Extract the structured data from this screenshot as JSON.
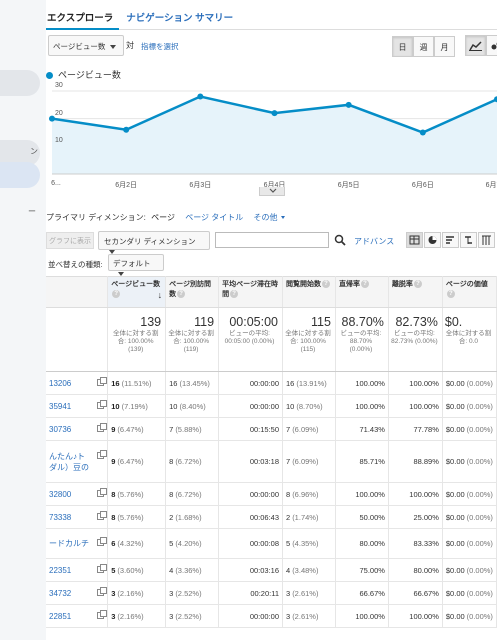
{
  "sidebar": {
    "text_a": "ン",
    "text_b": "ー"
  },
  "tabs": {
    "explorer": "エクスプローラ",
    "nav_summary": "ナビゲーション サマリー"
  },
  "metric_row": {
    "metric_select": "ページビュー数",
    "vs": "対",
    "select_metric_link": "指標を選択",
    "period_day": "日",
    "period_week": "週",
    "period_month": "月"
  },
  "legend": {
    "label": "ページビュー数",
    "color": "#058dc7"
  },
  "chart_data": {
    "type": "area",
    "series": [
      {
        "name": "ページビュー数",
        "values": [
          20,
          16,
          28,
          22,
          25,
          15,
          27
        ]
      }
    ],
    "x": [
      "6...",
      "6月2日",
      "6月3日",
      "6月4日",
      "6月5日",
      "6月6日",
      "6月7"
    ],
    "yticks": [
      "30",
      "20",
      "10"
    ],
    "ylim": [
      0,
      30
    ],
    "grid": true,
    "line_color": "#058dc7",
    "fill_color": "#e6f3fa"
  },
  "dimensions": {
    "label": "プライマリ ディメンション:",
    "active": "ページ",
    "page_title": "ページ タイトル",
    "other": "その他"
  },
  "toolbar": {
    "graph_btn": "グラフに表示",
    "secondary_dim": "セカンダリ ディメンション",
    "search_placeholder": "",
    "advanced": "アドバンス"
  },
  "sort": {
    "label": "並べ替えの種類:",
    "value": "デフォルト"
  },
  "table": {
    "headers": {
      "pv": "ページビュー数",
      "upv": "ページ別訪問数",
      "avg_time": "平均ページ滞在時間",
      "entrances": "閲覧開始数",
      "bounce": "直帰率",
      "exit": "離脱率",
      "value": "ページの価値"
    },
    "summary": {
      "pv": "139",
      "pv_sub": "全体に対する割合: 100.00% (139)",
      "upv": "119",
      "upv_sub": "全体に対する割合: 100.00% (119)",
      "avg_time": "00:05:00",
      "avg_time_sub": "ビューの平均: 00:05:00 (0.00%)",
      "entrances": "115",
      "entrances_sub": "全体に対する割合: 100.00% (115)",
      "bounce": "88.70%",
      "bounce_sub": "ビューの平均: 88.70% (0.00%)",
      "exit": "82.73%",
      "exit_sub": "ビューの平均: 82.73% (0.00%)",
      "value": "$0.",
      "value_sub": "全体に対する割合: 0.0"
    },
    "rows": [
      {
        "page": "13206",
        "pv": "16",
        "pv_pct": "(11.51%)",
        "upv": "16",
        "upv_pct": "(13.45%)",
        "avg": "00:00:00",
        "ent": "16",
        "ent_pct": "(13.91%)",
        "bounce": "100.00%",
        "exit": "100.00%",
        "value": "$0.00",
        "value_pct": "(0.00%)"
      },
      {
        "page": "35941",
        "pv": "10",
        "pv_pct": "(7.19%)",
        "upv": "10",
        "upv_pct": "(8.40%)",
        "avg": "00:00:00",
        "ent": "10",
        "ent_pct": "(8.70%)",
        "bounce": "100.00%",
        "exit": "100.00%",
        "value": "$0.00",
        "value_pct": "(0.00%)"
      },
      {
        "page": "30736",
        "pv": "9",
        "pv_pct": "(6.47%)",
        "upv": "7",
        "upv_pct": "(5.88%)",
        "avg": "00:15:50",
        "ent": "7",
        "ent_pct": "(6.09%)",
        "bounce": "71.43%",
        "exit": "77.78%",
        "value": "$0.00",
        "value_pct": "(0.00%)"
      },
      {
        "page": "んたん♪ト\nダル）豆の",
        "pv": "9",
        "pv_pct": "(6.47%)",
        "upv": "8",
        "upv_pct": "(6.72%)",
        "avg": "00:03:18",
        "ent": "7",
        "ent_pct": "(6.09%)",
        "bounce": "85.71%",
        "exit": "88.89%",
        "value": "$0.00",
        "value_pct": "(0.00%)"
      },
      {
        "page": "32800",
        "pv": "8",
        "pv_pct": "(5.76%)",
        "upv": "8",
        "upv_pct": "(6.72%)",
        "avg": "00:00:00",
        "ent": "8",
        "ent_pct": "(6.96%)",
        "bounce": "100.00%",
        "exit": "100.00%",
        "value": "$0.00",
        "value_pct": "(0.00%)"
      },
      {
        "page": "73338",
        "pv": "8",
        "pv_pct": "(5.76%)",
        "upv": "2",
        "upv_pct": "(1.68%)",
        "avg": "00:06:43",
        "ent": "2",
        "ent_pct": "(1.74%)",
        "bounce": "50.00%",
        "exit": "25.00%",
        "value": "$0.00",
        "value_pct": "(0.00%)"
      },
      {
        "page": "ードカルチ",
        "pv": "6",
        "pv_pct": "(4.32%)",
        "upv": "5",
        "upv_pct": "(4.20%)",
        "avg": "00:00:08",
        "ent": "5",
        "ent_pct": "(4.35%)",
        "bounce": "80.00%",
        "exit": "83.33%",
        "value": "$0.00",
        "value_pct": "(0.00%)"
      },
      {
        "page": "22351",
        "pv": "5",
        "pv_pct": "(3.60%)",
        "upv": "4",
        "upv_pct": "(3.36%)",
        "avg": "00:03:16",
        "ent": "4",
        "ent_pct": "(3.48%)",
        "bounce": "75.00%",
        "exit": "80.00%",
        "value": "$0.00",
        "value_pct": "(0.00%)"
      },
      {
        "page": "34732",
        "pv": "3",
        "pv_pct": "(2.16%)",
        "upv": "3",
        "upv_pct": "(2.52%)",
        "avg": "00:20:11",
        "ent": "3",
        "ent_pct": "(2.61%)",
        "bounce": "66.67%",
        "exit": "66.67%",
        "value": "$0.00",
        "value_pct": "(0.00%)"
      },
      {
        "page": "22851",
        "pv": "3",
        "pv_pct": "(2.16%)",
        "upv": "3",
        "upv_pct": "(2.52%)",
        "avg": "00:00:00",
        "ent": "3",
        "ent_pct": "(2.61%)",
        "bounce": "100.00%",
        "exit": "100.00%",
        "value": "$0.00",
        "value_pct": "(0.00%)"
      }
    ]
  }
}
